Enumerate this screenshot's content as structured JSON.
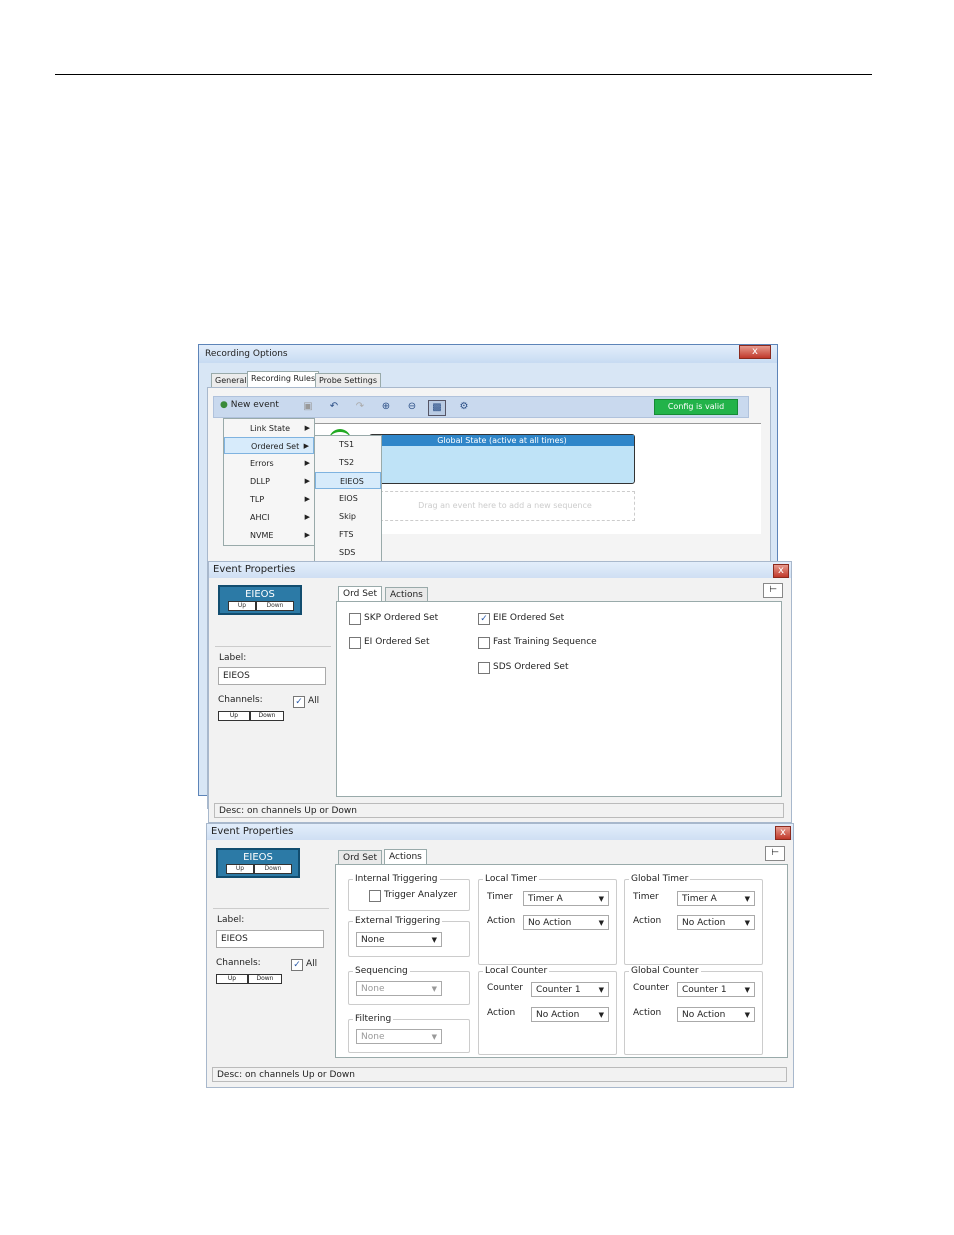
{
  "recording_options": {
    "title": "Recording Options",
    "close": "x",
    "tabs": [
      "General",
      "Recording Rules",
      "Probe Settings"
    ],
    "toolbar": {
      "new_event": "New event",
      "config_status": "Config is valid"
    },
    "global_state": "Global State (active at all times)",
    "drag_hint": "Drag an event here to add a new sequence",
    "menu": [
      "Link State",
      "Ordered Set",
      "Errors",
      "DLLP",
      "TLP",
      "AHCI",
      "NVME"
    ],
    "submenu": [
      "TS1",
      "TS2",
      "EIEOS",
      "EIOS",
      "Skip",
      "FTS",
      "SDS"
    ]
  },
  "event_properties_1": {
    "title": "Event Properties",
    "close": "x",
    "event_name": "EIEOS",
    "event_up": "Up",
    "event_down": "Down",
    "label_caption": "Label:",
    "label_value": "EIEOS",
    "channels_caption": "Channels:",
    "all": "All",
    "ch_up": "Up",
    "ch_down": "Down",
    "tabs": [
      "Ord Set",
      "Actions"
    ],
    "checkboxes": [
      {
        "label": "SKP Ordered Set",
        "checked": false
      },
      {
        "label": "EIE Ordered Set",
        "checked": true
      },
      {
        "label": "EI Ordered Set",
        "checked": false
      },
      {
        "label": "Fast Training Sequence",
        "checked": false
      },
      {
        "label": "SDS Ordered Set",
        "checked": false
      }
    ],
    "desc": "Desc:  on channels Up or Down"
  },
  "event_properties_2": {
    "title": "Event Properties",
    "close": "x",
    "event_name": "EIEOS",
    "event_up": "Up",
    "event_down": "Down",
    "label_caption": "Label:",
    "label_value": "EIEOS",
    "channels_caption": "Channels:",
    "all": "All",
    "ch_up": "Up",
    "ch_down": "Down",
    "tabs": [
      "Ord Set",
      "Actions"
    ],
    "internal_triggering": "Internal Triggering",
    "trigger_analyzer": "Trigger Analyzer",
    "external_triggering": "External Triggering",
    "external_value": "None",
    "sequencing": "Sequencing",
    "sequencing_value": "None",
    "filtering": "Filtering",
    "filtering_value": "None",
    "local_timer": "Local Timer",
    "global_timer": "Global Timer",
    "timer_caption": "Timer",
    "action_caption": "Action",
    "timer_value": "Timer A",
    "no_action": "No Action",
    "local_counter": "Local Counter",
    "global_counter": "Global Counter",
    "counter_caption": "Counter",
    "counter_value": "Counter 1",
    "desc": "Desc:  on channels Up or Down"
  }
}
